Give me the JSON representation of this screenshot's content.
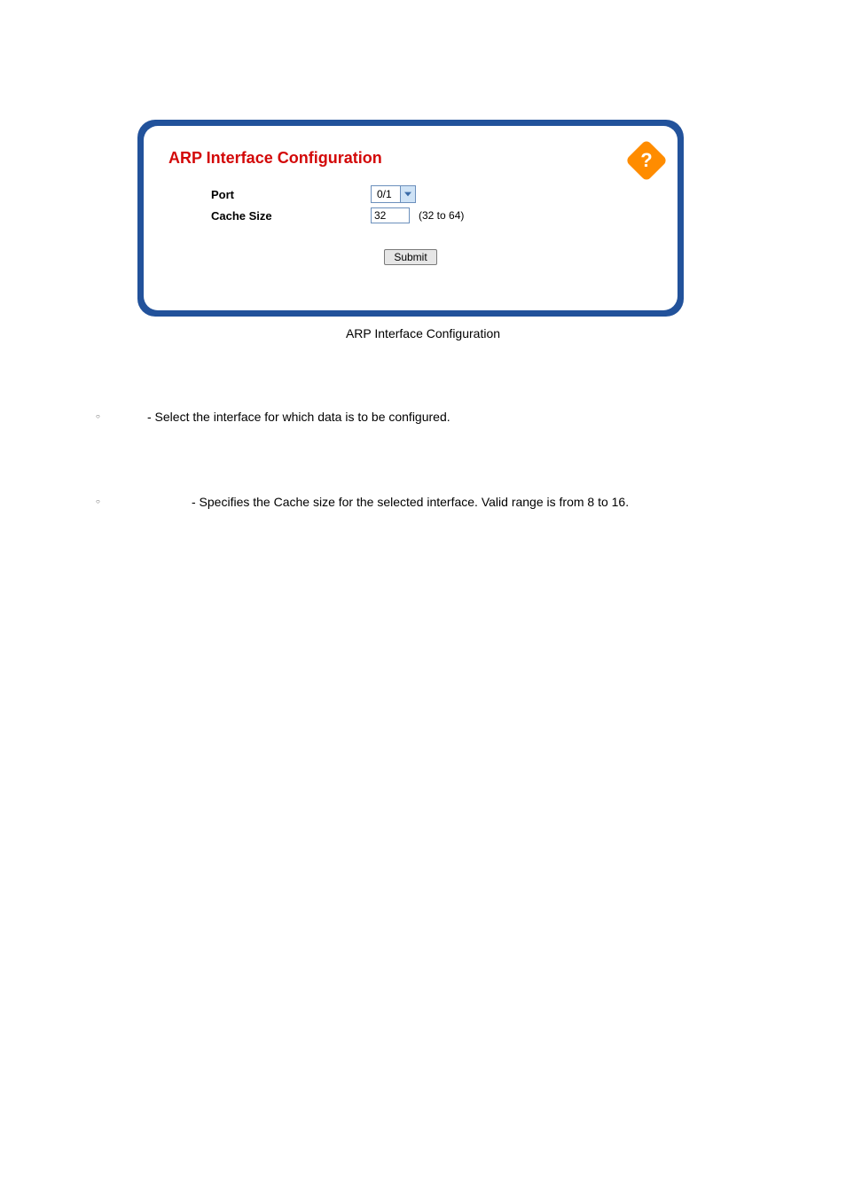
{
  "panel": {
    "title": "ARP Interface Configuration",
    "help_symbol": "?",
    "rows": {
      "port": {
        "label": "Port",
        "value": "0/1"
      },
      "cache_size": {
        "label": "Cache Size",
        "value": "32",
        "hint": "(32 to 64)"
      }
    },
    "submit_label": "Submit"
  },
  "caption": "ARP Interface Configuration",
  "bullets": {
    "b1": "- Select the interface for which data is to be configured.",
    "b2": "- Specifies the Cache size for the selected interface. Valid range is from 8 to 16."
  }
}
